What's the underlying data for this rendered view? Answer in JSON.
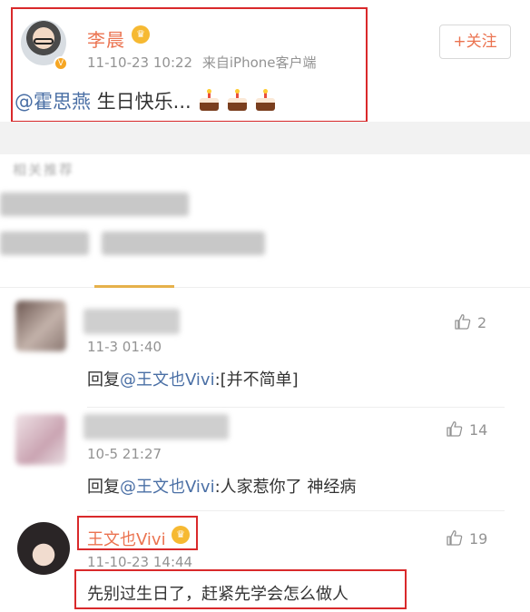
{
  "post": {
    "author": "李晨",
    "timestamp": "11-10-23 10:22",
    "source": "来自iPhone客户端",
    "follow_label": "+关注",
    "mention": "@霍思燕",
    "text": " 生日快乐...",
    "emoji": "cake-icon",
    "emoji_count": 3
  },
  "recommendations": {
    "header": "相关推荐"
  },
  "comments": [
    {
      "time": "11-3 01:40",
      "reply_prefix": "回复",
      "mention": "@王文也Vivi",
      "text": ":[并不简单]",
      "likes": "2"
    },
    {
      "time": "10-5 21:27",
      "reply_prefix": "回复",
      "mention": "@王文也Vivi",
      "text": ":人家惹你了 神经病",
      "likes": "14"
    },
    {
      "name": "王文也Vivi",
      "time": "11-10-23 14:44",
      "text": "先别过生日了，赶紧先学会怎么做人",
      "likes": "19"
    }
  ],
  "colors": {
    "username": "#eb7350",
    "mention": "#4a6fa5",
    "highlight_box": "#d9292b",
    "tab_indicator": "#e6b14b"
  }
}
